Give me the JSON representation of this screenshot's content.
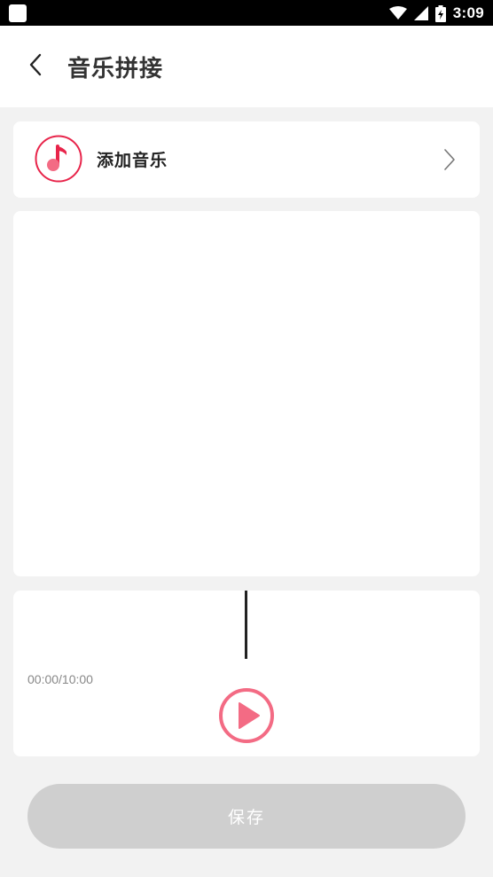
{
  "status_bar": {
    "time": "3:09",
    "icons": [
      "app-square-icon",
      "wifi-icon",
      "signal-icon",
      "battery-charging-icon"
    ]
  },
  "header": {
    "back_icon": "chevron-left-icon",
    "title": "音乐拼接"
  },
  "add_music": {
    "label": "添加音乐",
    "icon": "music-note-icon",
    "chevron_icon": "chevron-right-icon"
  },
  "player": {
    "time_readout": "00:00/10:00",
    "play_icon": "play-icon"
  },
  "actions": {
    "save_label": "保存"
  },
  "colors": {
    "accent": "#f36b84",
    "accent_dark": "#e8244a",
    "save_disabled_bg": "#cfcfcf",
    "page_bg": "#f2f2f2"
  }
}
